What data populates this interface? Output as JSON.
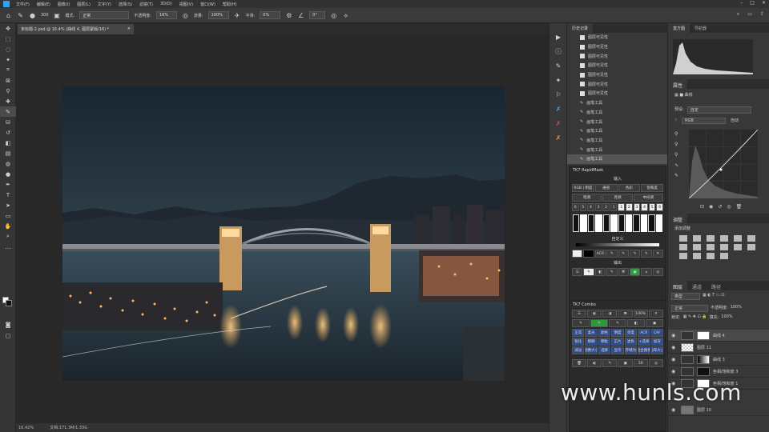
{
  "menubar": {
    "items": [
      "文件(F)",
      "编辑(E)",
      "图像(I)",
      "图层(L)",
      "文字(Y)",
      "选择(S)",
      "滤镜(T)",
      "3D(D)",
      "视图(V)",
      "窗口(W)",
      "帮助(H)"
    ]
  },
  "options": {
    "mode_label": "模式:",
    "mode_value": "正常",
    "opacity_label": "不透明度:",
    "opacity_value": "16%",
    "flow_label": "流量:",
    "flow_value": "100%",
    "smooth_label": "平滑:",
    "smooth_value": "0%",
    "angle_value": "0°",
    "brush_size": "300"
  },
  "document": {
    "tab_title": "未标题-2.psd @ 16.4% (曲线 4, 图层蒙版/16) *",
    "zoom": "16.42%",
    "doc_info": "文档:171.3M/1.33G"
  },
  "history": {
    "tabs": [
      "历史记录"
    ],
    "items": [
      {
        "label": "图层可见性",
        "selected": false
      },
      {
        "label": "图层可见性",
        "selected": false
      },
      {
        "label": "图层可见性",
        "selected": false
      },
      {
        "label": "图层可见性",
        "selected": false
      },
      {
        "label": "图层可见性",
        "selected": false
      },
      {
        "label": "图层可见性",
        "selected": false
      },
      {
        "label": "图层可见性",
        "selected": false
      },
      {
        "label": "画笔工具",
        "selected": false
      },
      {
        "label": "画笔工具",
        "selected": false
      },
      {
        "label": "画笔工具",
        "selected": false
      },
      {
        "label": "画笔工具",
        "selected": false
      },
      {
        "label": "画笔工具",
        "selected": false
      },
      {
        "label": "画笔工具",
        "selected": false
      },
      {
        "label": "画笔工具",
        "selected": true
      }
    ]
  },
  "rapidmask": {
    "title": "TK7 RapidMask",
    "input_label": "输入",
    "row1": [
      "RGB | 明度",
      "通道",
      "色彩",
      "饱和度"
    ],
    "row2": [
      "暗调",
      "亮调",
      "中间调"
    ],
    "numbers": [
      "6",
      "5",
      "4",
      "3",
      "2",
      "1",
      "1",
      "2",
      "3",
      "4",
      "5",
      "6"
    ],
    "custom_label": "自定义",
    "output_label": "输出",
    "acr_label": "ACR"
  },
  "combo": {
    "title": "TK7 Combo",
    "zoom": "100%",
    "buttons": [
      "正常",
      "柔光",
      "颜色",
      "明度",
      "亮度",
      "ACR",
      "CAF",
      "锐化",
      "模糊",
      "颗粒",
      "正片",
      "滤色",
      "+选择",
      "加深",
      "减淡",
      "图像大小",
      "选择",
      "显示",
      "存储为",
      "混合图像",
      "画布大小"
    ],
    "opacity_value": "50"
  },
  "histogram_panel": {
    "tabs": [
      "直方图",
      "导航器"
    ]
  },
  "properties": {
    "title": "属性",
    "subtitle": "曲线",
    "preset_label": "预设:",
    "preset_value": "自定",
    "channel_value": "RGB",
    "auto_label": "自动"
  },
  "adjustments": {
    "title": "调整",
    "add_label": "添加调整"
  },
  "layers": {
    "tabs": [
      "图层",
      "通道",
      "路径"
    ],
    "kind_label": "类型",
    "blend_value": "正常",
    "opacity_label": "不透明度:",
    "opacity_value": "100%",
    "fill_label": "填充:",
    "fill_value": "100%",
    "lock_label": "锁定:",
    "items": [
      {
        "name": "曲线 4",
        "selected": true,
        "thumb": "#ffffff"
      },
      {
        "name": "图层 11",
        "selected": false,
        "thumb": "#dddddd"
      },
      {
        "name": "曲线 3",
        "selected": false,
        "thumb": "#ffffff"
      },
      {
        "name": "色相/饱和度 3",
        "selected": false,
        "thumb": "#111111"
      },
      {
        "name": "色相/饱和度 1",
        "selected": false,
        "thumb": "#ffffff"
      },
      {
        "name": "图层 10",
        "selected": false,
        "thumb": "#777777"
      }
    ]
  },
  "watermark": {
    "text": "www.hunls.com"
  }
}
